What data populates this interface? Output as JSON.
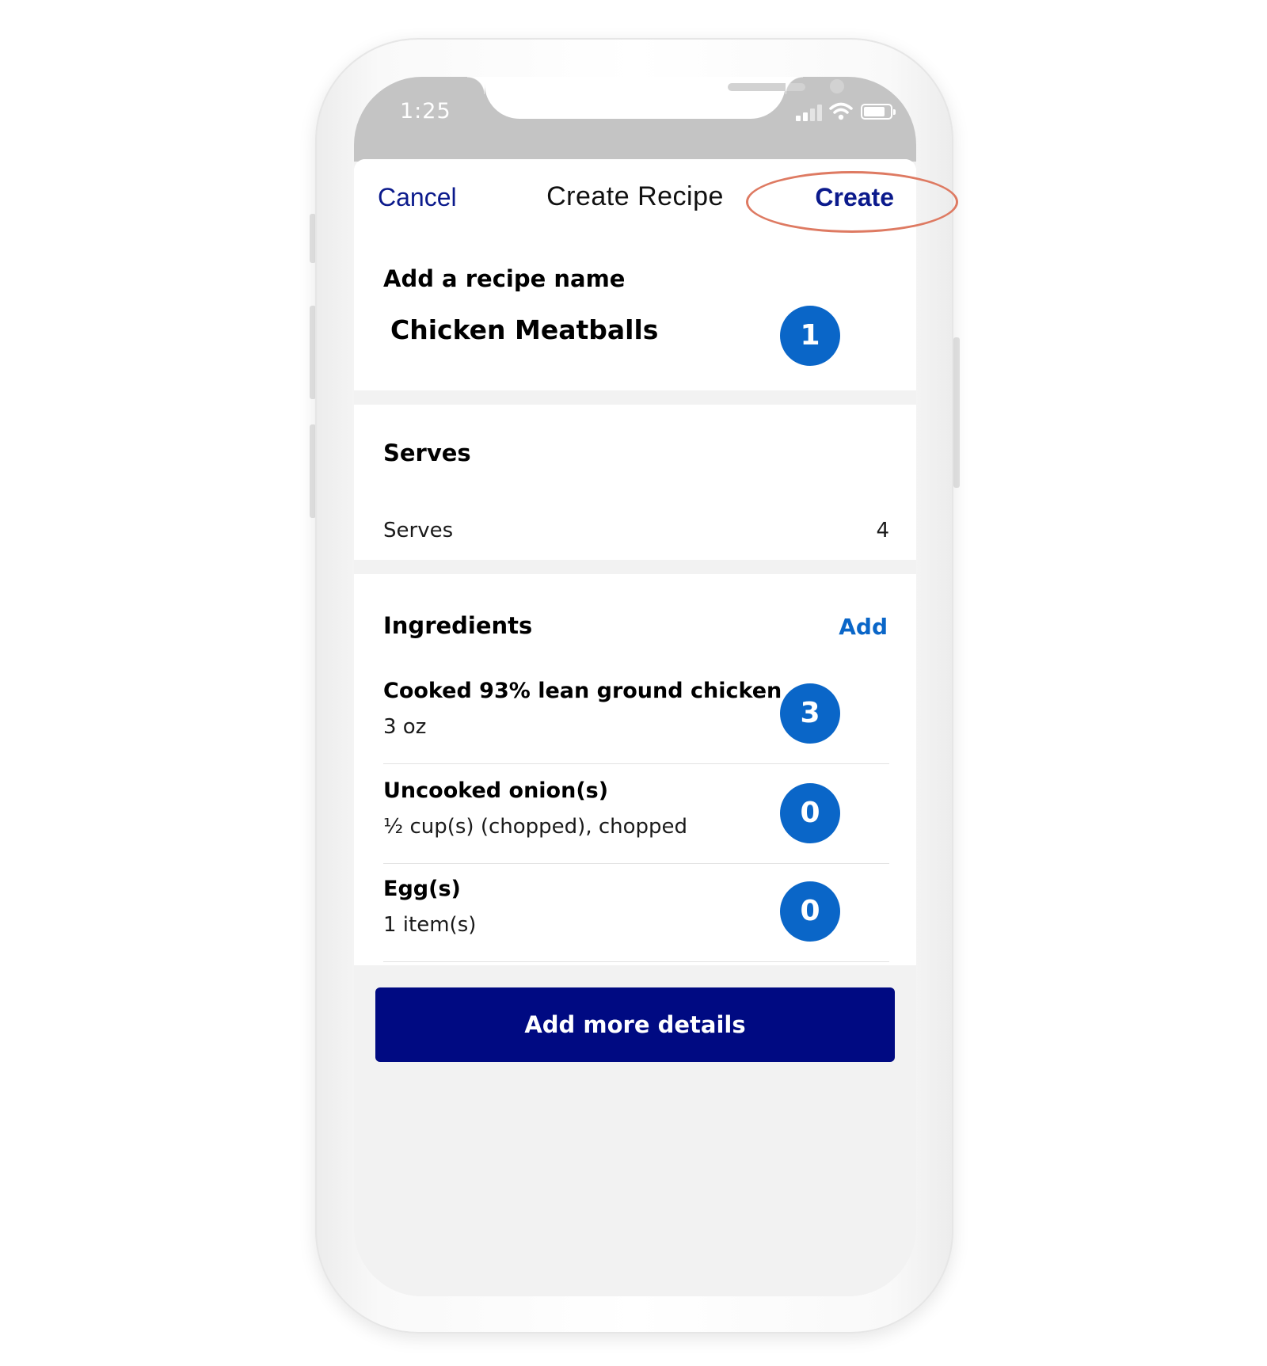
{
  "status_bar": {
    "time": "1:25",
    "icons": [
      "cellular-signal-icon",
      "wifi-icon",
      "battery-icon"
    ]
  },
  "nav": {
    "cancel_label": "Cancel",
    "title": "Create Recipe",
    "create_label": "Create"
  },
  "recipe_name": {
    "heading": "Add a recipe name",
    "value": "Chicken Meatballs",
    "badge": "1"
  },
  "serves": {
    "heading": "Serves",
    "label": "Serves",
    "value": "4"
  },
  "ingredients": {
    "heading": "Ingredients",
    "add_label": "Add",
    "items": [
      {
        "name": "Cooked 93% lean ground chicken",
        "amount": "3 oz",
        "points": "3"
      },
      {
        "name": "Uncooked onion(s)",
        "amount": "½ cup(s) (chopped), chopped",
        "points": "0"
      },
      {
        "name": "Egg(s)",
        "amount": "1 item(s)",
        "points": "0"
      }
    ]
  },
  "cta": {
    "label": "Add more details"
  },
  "colors": {
    "nav_link": "#0b1a8c",
    "badge": "#0a66c8",
    "cta": "#000a82",
    "highlight_ring": "#de7a62",
    "status_bar": "#c4c4c4"
  }
}
